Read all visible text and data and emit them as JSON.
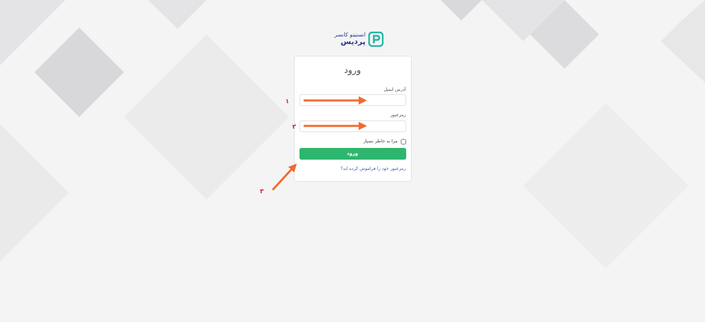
{
  "logo": {
    "tagline": "انستیتو کانسر",
    "brand": "پردیس"
  },
  "login_card": {
    "title": "ورود",
    "fields": [
      {
        "label": "آدرس ایمیل"
      },
      {
        "label": "رمزعبور"
      }
    ],
    "remember_me": {
      "label": "مرا به خاطر بسپار",
      "checked": false
    },
    "submit_button": "ورود",
    "forgot_link": "رمزعبور خود را فراموش کرده اید؟"
  },
  "annotations": [
    {
      "number": "۱"
    },
    {
      "number": "۲"
    },
    {
      "number": "۳"
    }
  ]
}
